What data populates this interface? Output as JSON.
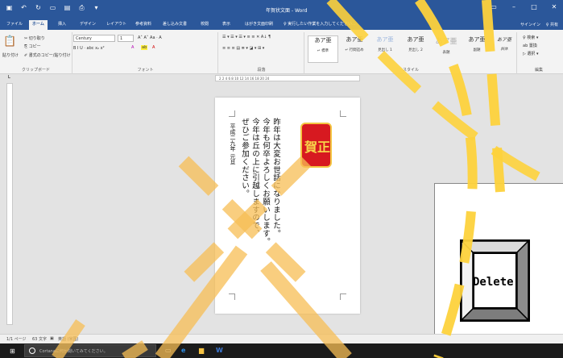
{
  "window": {
    "title": "年賀状文面 - Word",
    "controls": {
      "ribbon_options": "▭",
      "minimize": "–",
      "maximize": "□",
      "close": "✕"
    }
  },
  "qat": {
    "save_icon": "save-icon",
    "undo_icon": "undo-icon",
    "redo_icon": "redo-icon",
    "new_icon": "new-doc-icon",
    "open_icon": "open-icon",
    "print_icon": "print-preview-icon"
  },
  "tabs": {
    "file": "ファイル",
    "home": "ホーム",
    "insert": "挿入",
    "design": "デザイン",
    "layout": "レイアウト",
    "references": "参考資料",
    "mailings": "差し込み文書",
    "review": "校閲",
    "view": "表示",
    "postcard": "はがき文面印刷",
    "tell_me": "♀ 実行したい作業を入力してください...",
    "signin": "サインイン",
    "share": "♀ 共有"
  },
  "ribbon": {
    "clipboard": {
      "paste": "貼り付け",
      "cut": "✂ 切り取り",
      "copy": "⎘ コピー",
      "format_painter": "✐ 書式のコピー/貼り付け",
      "label": "クリップボード"
    },
    "font": {
      "name": "Century",
      "size": "1",
      "buttons": "B  I  U  ·  abc  x₂  x²",
      "case_row": "A˄  A˅  Aa  ·  A",
      "label": "フォント"
    },
    "paragraph": {
      "label": "段落"
    },
    "styles": {
      "label": "スタイル",
      "items": [
        {
          "sample": "あア亜",
          "name": "↵ 標準"
        },
        {
          "sample": "あア亜",
          "name": "↵ 行間詰め"
        },
        {
          "sample": "あア亜",
          "name": "見出し 1"
        },
        {
          "sample": "あア亜",
          "name": "見出し 2"
        },
        {
          "sample": "あア亜",
          "name": "表題"
        },
        {
          "sample": "あア亜",
          "name": "副題"
        },
        {
          "sample": "あア亜",
          "name": "斜体"
        }
      ]
    },
    "editing": {
      "find": "♀ 検索 ▾",
      "replace": "ab 置換",
      "select": "▷ 選択 ▾",
      "label": "編集"
    }
  },
  "ruler": {
    "ticks": "2     2   4   6   8   10   12   14   16   18   20     24"
  },
  "document": {
    "seal_chars": [
      "賀",
      "正"
    ],
    "body_lines": [
      "昨年は大変お世話になりました。",
      "今年も何卒よろしくお願いします。",
      "今年は丘の上に引越しますので、",
      "ぜひご参加ください。"
    ],
    "date_line": "平成二九年 元旦"
  },
  "status": {
    "page": "1/1 ページ",
    "words": "63 文字",
    "lang": "英語 (米国)"
  },
  "taskbar": {
    "search_placeholder": "Cortanaに何か聞いてみてください。"
  },
  "delete_key": {
    "label": "Delete"
  },
  "colors": {
    "word_blue": "#2b579a",
    "seal_red": "#d71920",
    "seal_gold": "#f7d44a",
    "annotation_yellow": "#fdd23c",
    "cross_orange": "#f7be55"
  }
}
